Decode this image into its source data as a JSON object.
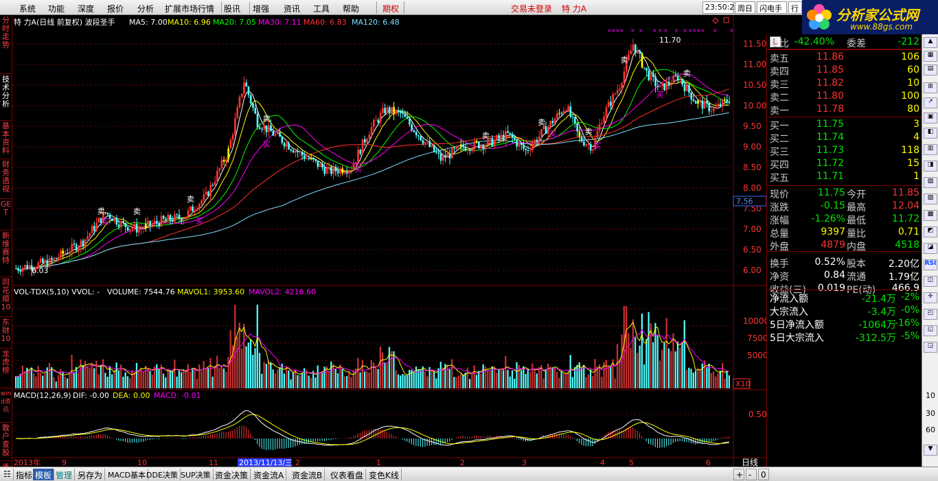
{
  "menu": {
    "items": [
      "系统",
      "功能",
      "深度",
      "报价",
      "分析",
      "扩展市场行情",
      "股讯",
      "增强",
      "资讯",
      "工具",
      "帮助"
    ],
    "period": "期权",
    "login_status": "交易未登录",
    "stock_name": "特 力A",
    "clock": "23:50:20",
    "weekday": "周日",
    "flash_trade": "闪电手",
    "trade": "行"
  },
  "logo": {
    "brand": "分析家公式网",
    "url": "www.88gs.com"
  },
  "side_tabs": [
    "分时走势",
    "技术分析",
    "基本资料",
    "财务透视",
    "GET",
    "新维赛特",
    "同花顺10",
    "东财10",
    "龙虎榜",
    "wind资讯",
    "散户查股",
    "播"
  ],
  "main_chart": {
    "title": "特 力A(日线 前复权) 波段圣手",
    "ma": [
      {
        "label": "MA5: 7.00",
        "color": "#ffffff"
      },
      {
        "label": "MA10: 6.96",
        "color": "#ffff00"
      },
      {
        "label": "MA20: 7.05",
        "color": "#00ff00"
      },
      {
        "label": "MA30: 7.11",
        "color": "#ff00ff"
      },
      {
        "label": "MA60: 6.83",
        "color": "#ff3232"
      },
      {
        "label": "MA120: 6.48",
        "color": "#7fdfff"
      }
    ],
    "high_label": "11.70",
    "low_label": "6.03",
    "current_price_tag": "7.56",
    "price_ticks": [
      "11.50",
      "11.00",
      "10.50",
      "10.00",
      "9.50",
      "9.00",
      "8.50",
      "8.00",
      "7.50",
      "7.00",
      "6.50",
      "6.00"
    ],
    "buy_marker": "买",
    "sell_marker": "卖"
  },
  "volume_chart": {
    "title": "VOL-TDX(5,10) VVOL: -",
    "volume": "VOLUME: 7544.76",
    "mavol1": "MAVOL1: 3953.60",
    "mavol2": "MAVOL2: 4216.60",
    "ticks": [
      "10000",
      "7500",
      "5000"
    ],
    "unit": "X10"
  },
  "macd_chart": {
    "title": "MACD(12,26,9)",
    "dif": "DIF: -0.00",
    "dea": "DEA: 0.00",
    "macd": "MACD: -0.01",
    "tick": "0.50"
  },
  "time_axis": {
    "labels": [
      "2013年",
      "9",
      "10",
      "11",
      "2013/11/13/三",
      "2",
      "1",
      "2",
      "3",
      "4",
      "5",
      "6"
    ],
    "period_label": "日线"
  },
  "quote": {
    "header_icon": "L",
    "weibi_label": "委比",
    "weibi": "-42.40%",
    "weicha_label": "委差",
    "weicha": "-212",
    "asks": [
      {
        "label": "卖五",
        "price": "11.86",
        "vol": "106"
      },
      {
        "label": "卖四",
        "price": "11.85",
        "vol": "60"
      },
      {
        "label": "卖三",
        "price": "11.82",
        "vol": "10"
      },
      {
        "label": "卖二",
        "price": "11.80",
        "vol": "100"
      },
      {
        "label": "卖一",
        "price": "11.78",
        "vol": "80"
      }
    ],
    "bids": [
      {
        "label": "买一",
        "price": "11.75",
        "vol": "3"
      },
      {
        "label": "买二",
        "price": "11.74",
        "vol": "4"
      },
      {
        "label": "买三",
        "price": "11.73",
        "vol": "118"
      },
      {
        "label": "买四",
        "price": "11.72",
        "vol": "15"
      },
      {
        "label": "买五",
        "price": "11.71",
        "vol": "1"
      }
    ],
    "stats": [
      {
        "l1": "现价",
        "v1": "11.75",
        "c1": "green",
        "l2": "今开",
        "v2": "11.85",
        "c2": "red"
      },
      {
        "l1": "涨跌",
        "v1": "-0.15",
        "c1": "green",
        "l2": "最高",
        "v2": "12.04",
        "c2": "red"
      },
      {
        "l1": "涨幅",
        "v1": "-1.26%",
        "c1": "green",
        "l2": "最低",
        "v2": "11.72",
        "c2": "green"
      },
      {
        "l1": "总量",
        "v1": "9397",
        "c1": "yellow",
        "l2": "量比",
        "v2": "0.71",
        "c2": "yellow"
      },
      {
        "l1": "外盘",
        "v1": "4879",
        "c1": "red",
        "l2": "内盘",
        "v2": "4518",
        "c2": "green"
      },
      {
        "l1": "换手",
        "v1": "0.52%",
        "c1": "white",
        "l2": "股本",
        "v2": "2.20亿",
        "c2": "white"
      },
      {
        "l1": "净资",
        "v1": "0.84",
        "c1": "white",
        "l2": "流通",
        "v2": "1.79亿",
        "c2": "white"
      },
      {
        "l1": "收益(三)",
        "v1": "0.019",
        "c1": "white",
        "l2": "PE(动)",
        "v2": "466.9",
        "c2": "white"
      }
    ],
    "flows": [
      {
        "label": "净流入额",
        "value": "-21.4万",
        "pct": "-2%"
      },
      {
        "label": "大宗流入",
        "value": "-3.4万",
        "pct": "-0%"
      },
      {
        "label": "5日净流入额",
        "value": "-1064万",
        "pct": "-16%"
      },
      {
        "label": "5日大宗流入",
        "value": "-312.5万",
        "pct": "-5%"
      }
    ]
  },
  "right_toolbar": {
    "rsi": "RSI",
    "nums": [
      "10",
      "30",
      "60"
    ]
  },
  "bottom_tabs": [
    "指标",
    "模板",
    "管理",
    "另存为",
    "MACD基本",
    "DDE决策",
    "SUP决策",
    "资金决策",
    "资金流A",
    "资金流B",
    "仪表看盘",
    "变色K线"
  ],
  "bottom_right": [
    "+",
    "-",
    "0"
  ]
}
